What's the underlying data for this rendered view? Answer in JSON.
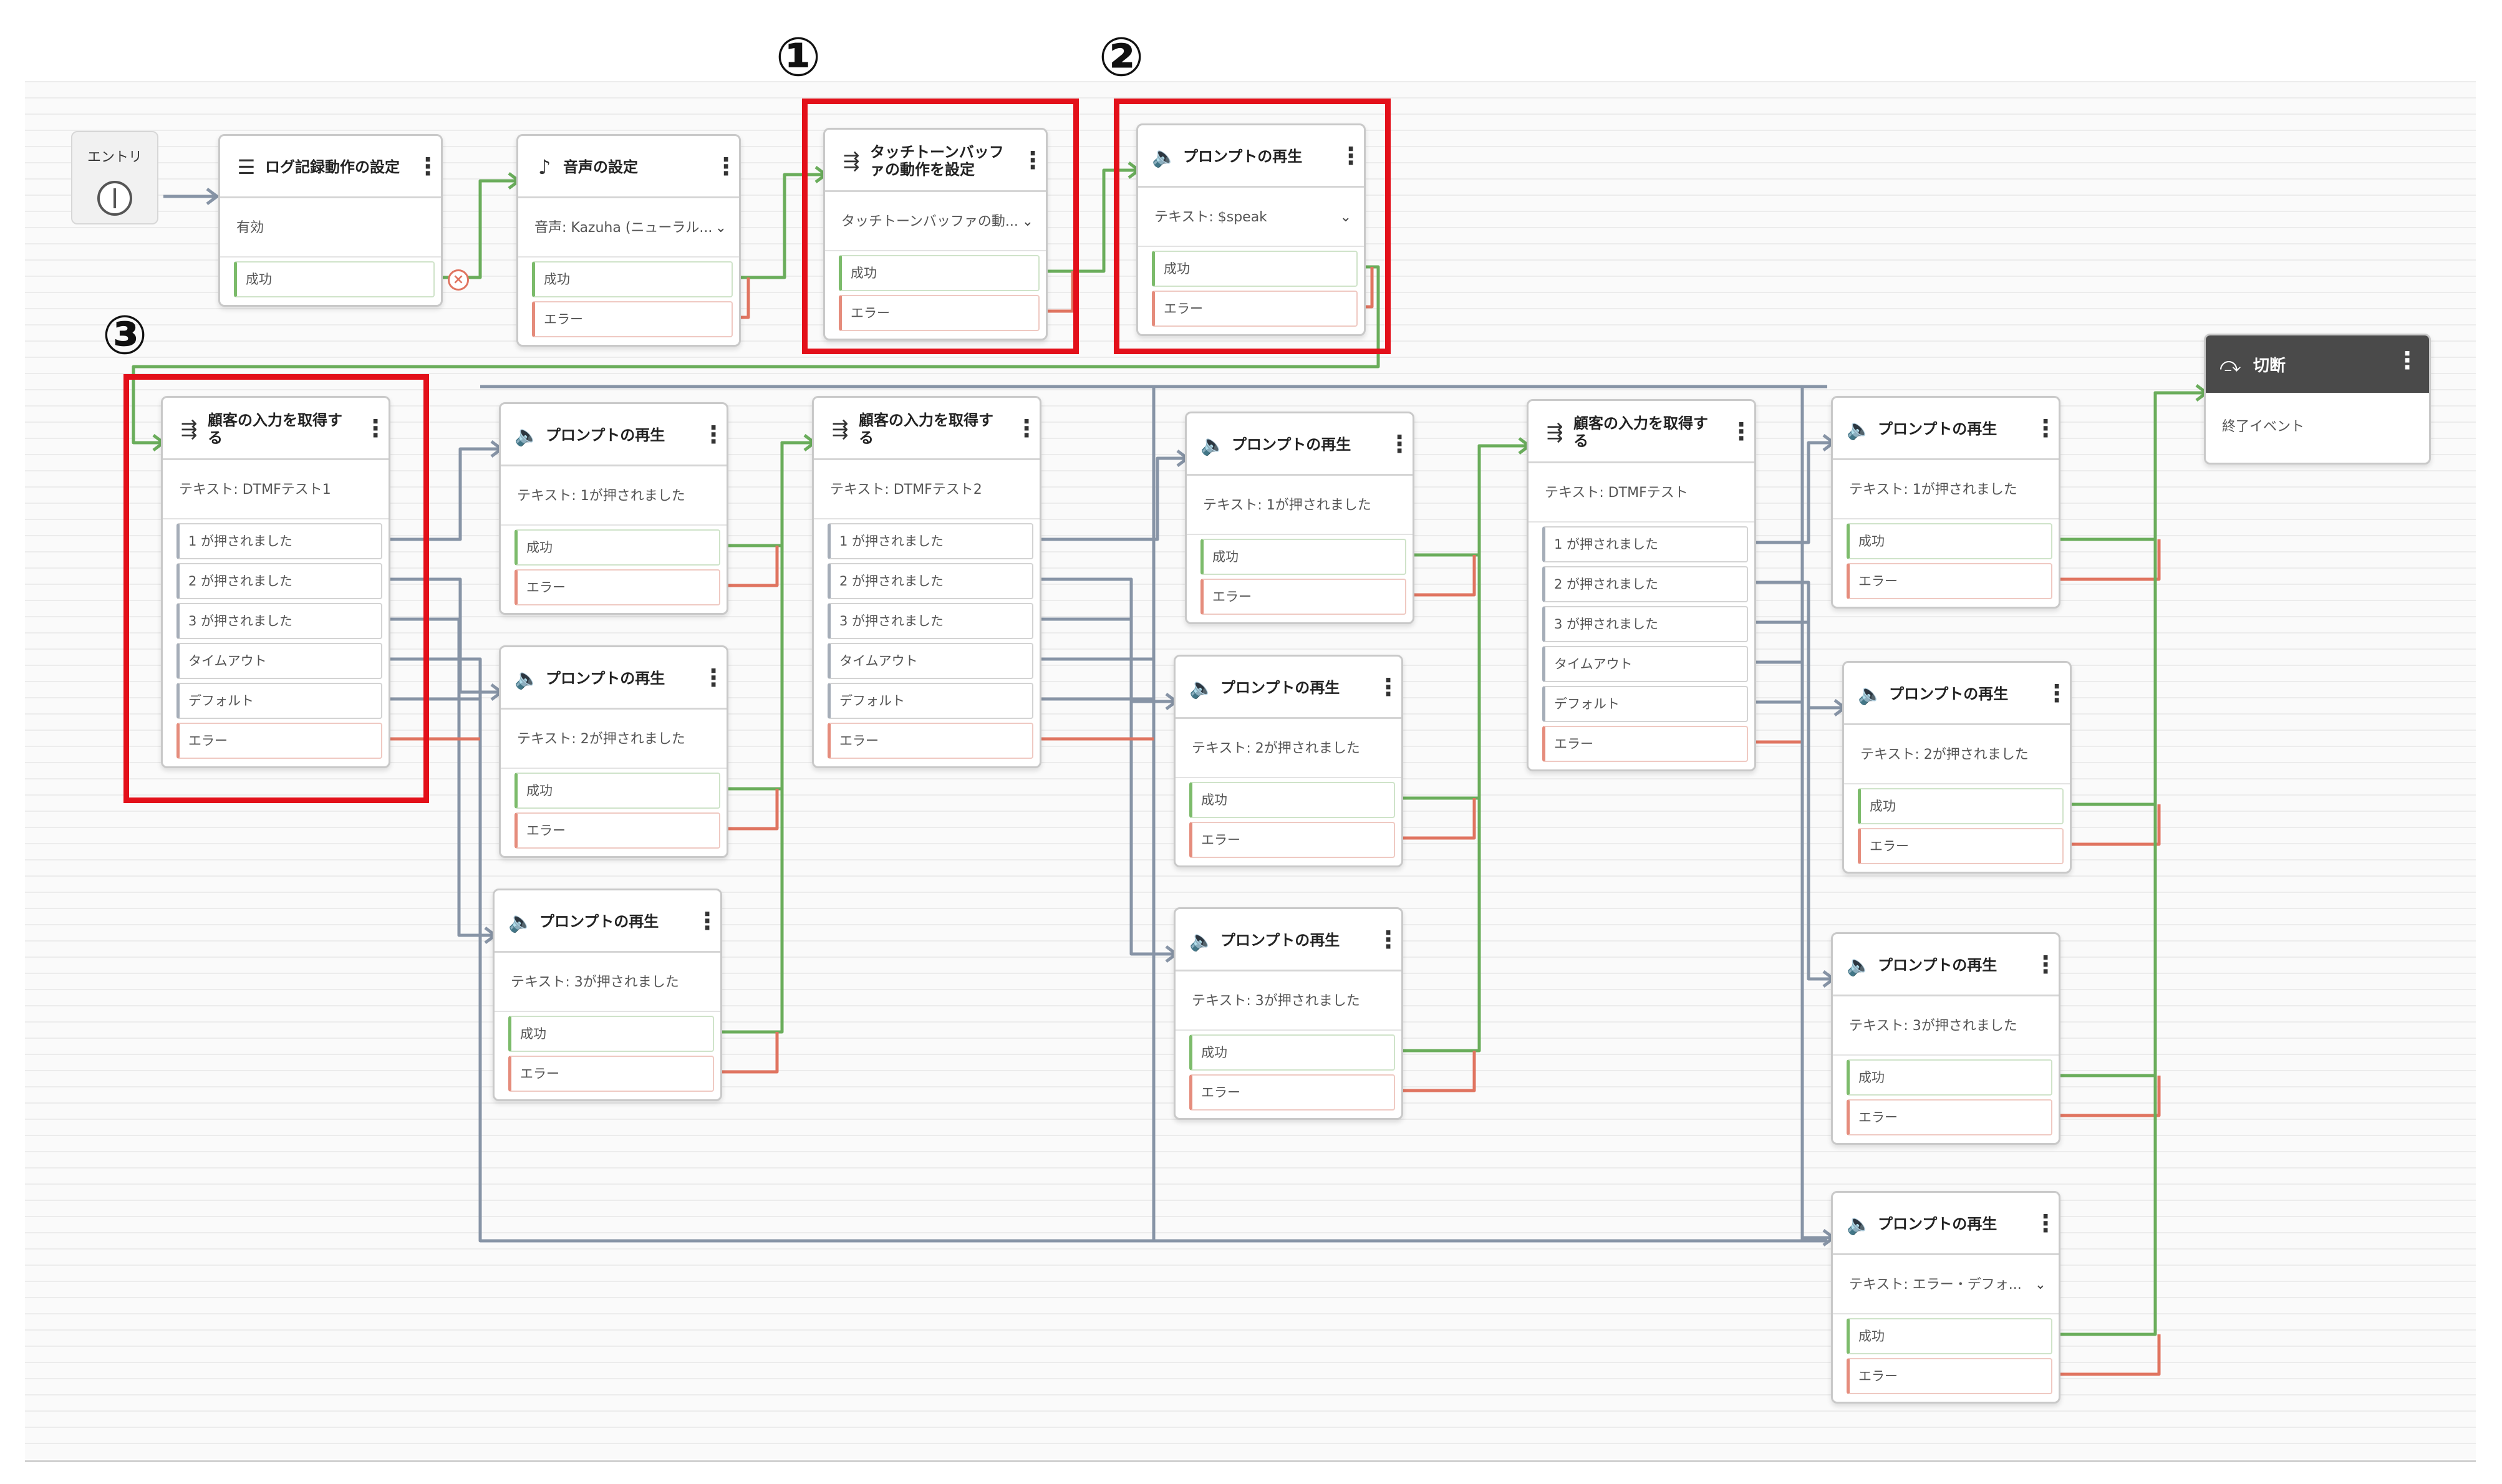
{
  "entry": {
    "label": "エントリ"
  },
  "markers": [
    "①",
    "②",
    "③"
  ],
  "icons": {
    "settings": "settings-icon",
    "voice": "voice-settings-icon",
    "input": "input-icon",
    "prompt": "speaker-icon",
    "end": "end-flow-icon",
    "menu": "menu-icon"
  },
  "colors": {
    "success_line": "#6aad5b",
    "error_line": "#e07460",
    "option_line": "#8794a6",
    "highlight": "#e3101a",
    "end_header": "#4a4a4a"
  },
  "nodes": {
    "logging": {
      "title": "ログ記録動作の設定",
      "body": "有効",
      "branches": [
        "成功"
      ]
    },
    "voice": {
      "title": "音声の設定",
      "body": "音声: Kazuha (ニューラル...",
      "branches": [
        "成功",
        "エラー"
      ]
    },
    "buffer": {
      "title": "タッチトーンバッファの動作を設定",
      "body": "タッチトーンバッファの動...",
      "branches": [
        "成功",
        "エラー"
      ]
    },
    "prompt_start": {
      "title": "プロンプトの再生",
      "body": "テキスト: $speak",
      "branches": [
        "成功",
        "エラー"
      ]
    },
    "input1": {
      "title": "顧客の入力を取得する",
      "body": "テキスト: DTMFテスト1",
      "branches": [
        "1 が押されました",
        "2 が押されました",
        "3 が押されました",
        "タイムアウト",
        "デフォルト",
        "エラー"
      ]
    },
    "p1_1": {
      "title": "プロンプトの再生",
      "body": "テキスト: 1が押されました",
      "branches": [
        "成功",
        "エラー"
      ]
    },
    "p1_2": {
      "title": "プロンプトの再生",
      "body": "テキスト: 2が押されました",
      "branches": [
        "成功",
        "エラー"
      ]
    },
    "p1_3": {
      "title": "プロンプトの再生",
      "body": "テキスト: 3が押されました",
      "branches": [
        "成功",
        "エラー"
      ]
    },
    "input2": {
      "title": "顧客の入力を取得する",
      "body": "テキスト: DTMFテスト2",
      "branches": [
        "1 が押されました",
        "2 が押されました",
        "3 が押されました",
        "タイムアウト",
        "デフォルト",
        "エラー"
      ]
    },
    "p2_1": {
      "title": "プロンプトの再生",
      "body": "テキスト: 1が押されました",
      "branches": [
        "成功",
        "エラー"
      ]
    },
    "p2_2": {
      "title": "プロンプトの再生",
      "body": "テキスト: 2が押されました",
      "branches": [
        "成功",
        "エラー"
      ]
    },
    "p2_3": {
      "title": "プロンプトの再生",
      "body": "テキスト: 3が押されました",
      "branches": [
        "成功",
        "エラー"
      ]
    },
    "input3": {
      "title": "顧客の入力を取得する",
      "body": "テキスト: DTMFテスト",
      "branches": [
        "1 が押されました",
        "2 が押されました",
        "3 が押されました",
        "タイムアウト",
        "デフォルト",
        "エラー"
      ]
    },
    "p3_1": {
      "title": "プロンプトの再生",
      "body": "テキスト: 1が押されました",
      "branches": [
        "成功",
        "エラー"
      ]
    },
    "p3_2": {
      "title": "プロンプトの再生",
      "body": "テキスト: 2が押されました",
      "branches": [
        "成功",
        "エラー"
      ]
    },
    "p3_3": {
      "title": "プロンプトの再生",
      "body": "テキスト: 3が押されました",
      "branches": [
        "成功",
        "エラー"
      ]
    },
    "p_error": {
      "title": "プロンプトの再生",
      "body": "テキスト: エラー・デフォ...",
      "branches": [
        "成功",
        "エラー"
      ]
    }
  },
  "end": {
    "title": "切断",
    "body": "終了イベント"
  }
}
